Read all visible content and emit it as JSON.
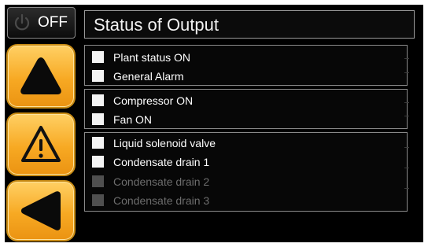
{
  "power_button": {
    "label": "OFF",
    "icon": "power-icon"
  },
  "title": "Status of Output",
  "nav_buttons": [
    {
      "icon": "triangle-up-icon",
      "color": "#f7a923"
    },
    {
      "icon": "warning-icon",
      "color": "#f7a923"
    },
    {
      "icon": "triangle-left-icon",
      "color": "#f7a923"
    }
  ],
  "groups": [
    {
      "items": [
        {
          "label": "Plant status ON",
          "enabled": true
        },
        {
          "label": "General Alarm",
          "enabled": true
        }
      ]
    },
    {
      "items": [
        {
          "label": "Compressor ON",
          "enabled": true
        },
        {
          "label": "Fan ON",
          "enabled": true
        }
      ]
    },
    {
      "items": [
        {
          "label": "Liquid solenoid valve",
          "enabled": true
        },
        {
          "label": "Condensate drain 1",
          "enabled": true
        },
        {
          "label": "Condensate drain 2",
          "enabled": false
        },
        {
          "label": "Condensate drain 3",
          "enabled": false
        }
      ]
    }
  ],
  "colors": {
    "accent": "#f7a923",
    "background": "#000000",
    "text": "#ffffff",
    "disabled_text": "#6d6d6d"
  }
}
